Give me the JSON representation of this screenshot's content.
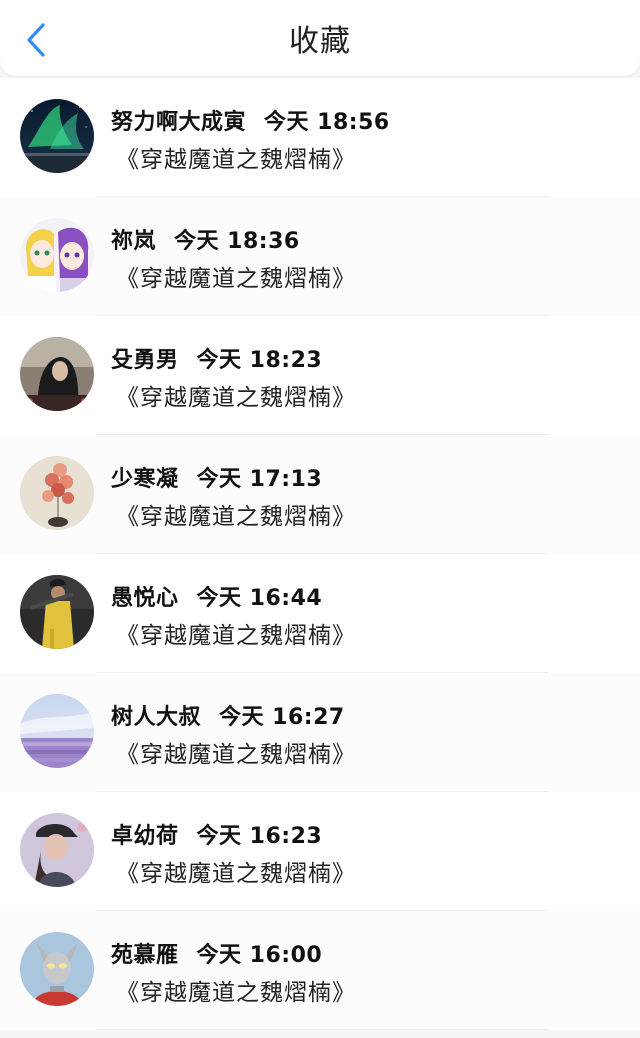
{
  "header": {
    "title": "收藏",
    "back_icon": "chevron-left-icon",
    "accent_color": "#2f8cf0"
  },
  "items": [
    {
      "username": "努力啊大成寅",
      "time": "今天 18:56",
      "subtitle": "《穿越魔道之魏熠楠》",
      "avatar_icon": "aurora-night-avatar"
    },
    {
      "username": "祢岚",
      "time": "今天 18:36",
      "subtitle": "《穿越魔道之魏熠楠》",
      "avatar_icon": "anime-girls-avatar"
    },
    {
      "username": "殳勇男",
      "time": "今天 18:23",
      "subtitle": "《穿越魔道之魏熠楠》",
      "avatar_icon": "dark-portrait-avatar"
    },
    {
      "username": "少寒凝",
      "time": "今天 17:13",
      "subtitle": "《穿越魔道之魏熠楠》",
      "avatar_icon": "balloons-avatar"
    },
    {
      "username": "愚悦心",
      "time": "今天 16:44",
      "subtitle": "《穿越魔道之魏熠楠》",
      "avatar_icon": "yellow-coat-figure-avatar"
    },
    {
      "username": "树人大叔",
      "time": "今天 16:27",
      "subtitle": "《穿越魔道之魏熠楠》",
      "avatar_icon": "lavender-field-avatar"
    },
    {
      "username": "卓幼荷",
      "time": "今天 16:23",
      "subtitle": "《穿越魔道之魏熠楠》",
      "avatar_icon": "cap-portrait-avatar"
    },
    {
      "username": "苑慕雁",
      "time": "今天 16:00",
      "subtitle": "《穿越魔道之魏熠楠》",
      "avatar_icon": "hero-mask-avatar"
    }
  ]
}
